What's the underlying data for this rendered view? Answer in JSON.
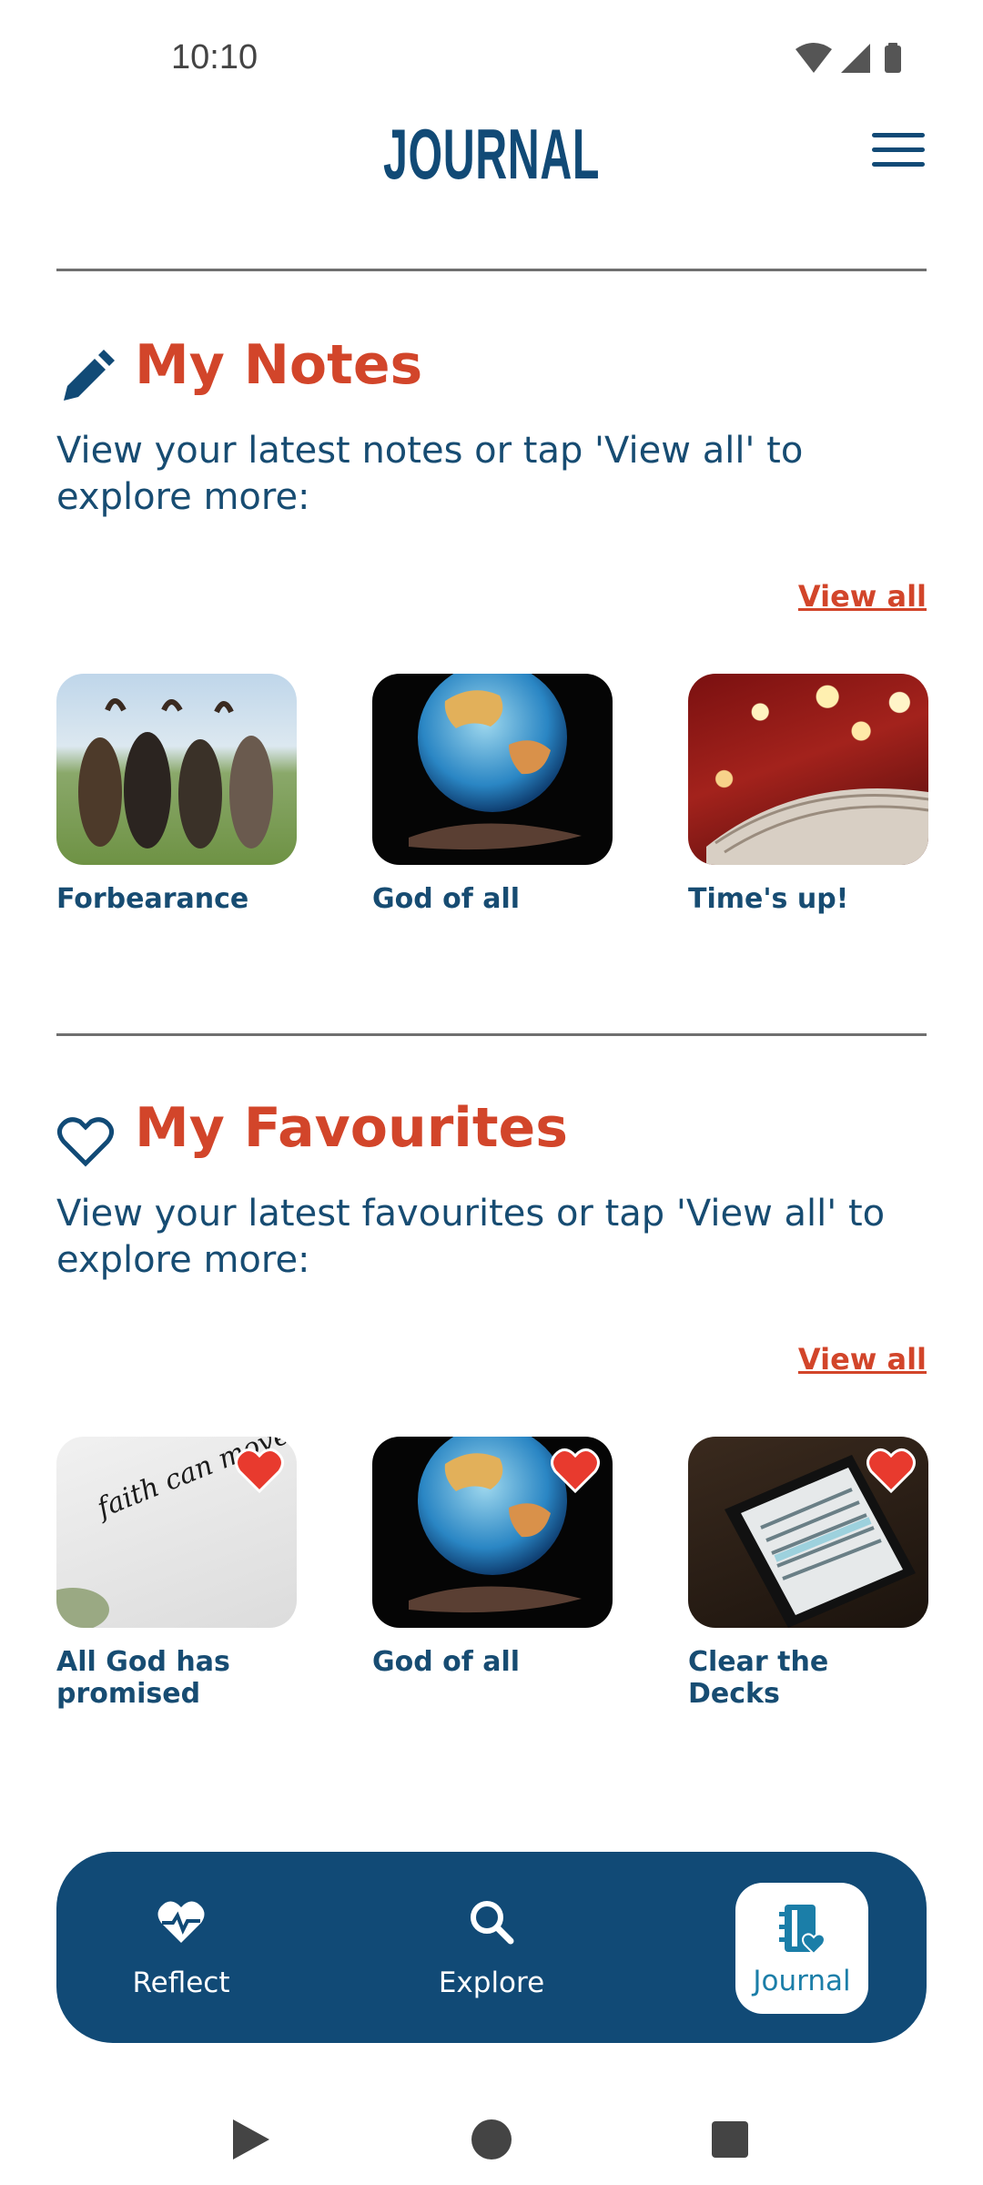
{
  "status_bar": {
    "time": "10:10"
  },
  "header": {
    "title": "JOURNAL"
  },
  "notes": {
    "title": "My Notes",
    "description": "View your latest notes or tap 'View all' to explore more:",
    "view_all": "View all",
    "items": [
      {
        "label": "Forbearance"
      },
      {
        "label": "God of all"
      },
      {
        "label": "Time's up!"
      }
    ]
  },
  "favourites": {
    "title": "My Favourites",
    "description": "View your latest favourites or tap 'View all' to explore more:",
    "view_all": "View all",
    "items": [
      {
        "label": "All God has promised",
        "image_text": "faith can move mountains"
      },
      {
        "label": "God of all"
      },
      {
        "label": "Clear the Decks"
      }
    ]
  },
  "bottom_nav": {
    "items": [
      {
        "label": "Reflect",
        "icon": "heart-pulse-icon"
      },
      {
        "label": "Explore",
        "icon": "search-icon"
      },
      {
        "label": "Journal",
        "icon": "journal-icon",
        "active": true
      }
    ]
  },
  "colors": {
    "primary": "#114a76",
    "accent": "#d2452a",
    "heart": "#e83a2e"
  }
}
